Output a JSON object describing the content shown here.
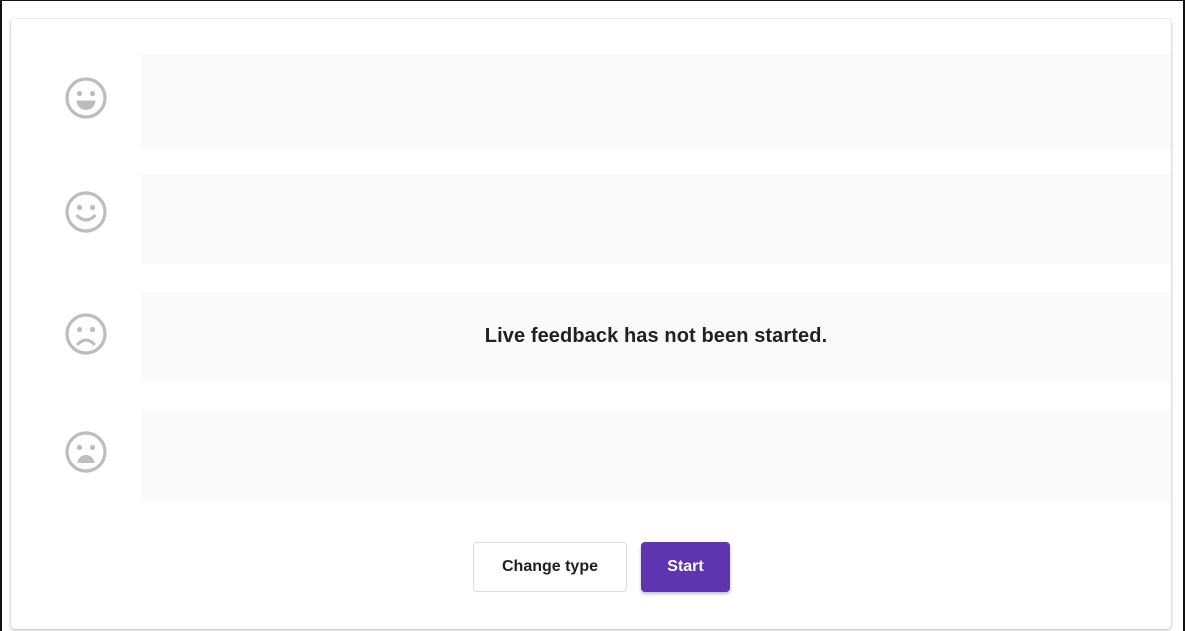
{
  "feedback": {
    "rows": [
      {
        "icon": "very-satisfied-face-icon"
      },
      {
        "icon": "satisfied-face-icon"
      },
      {
        "icon": "dissatisfied-face-icon"
      },
      {
        "icon": "very-dissatisfied-face-icon"
      }
    ],
    "status_message": "Live feedback has not been started."
  },
  "actions": {
    "change_type_label": "Change type",
    "start_label": "Start"
  },
  "colors": {
    "accent": "#5e35b1",
    "icon": "#bdbdbd",
    "bar_background": "#fafafa"
  }
}
